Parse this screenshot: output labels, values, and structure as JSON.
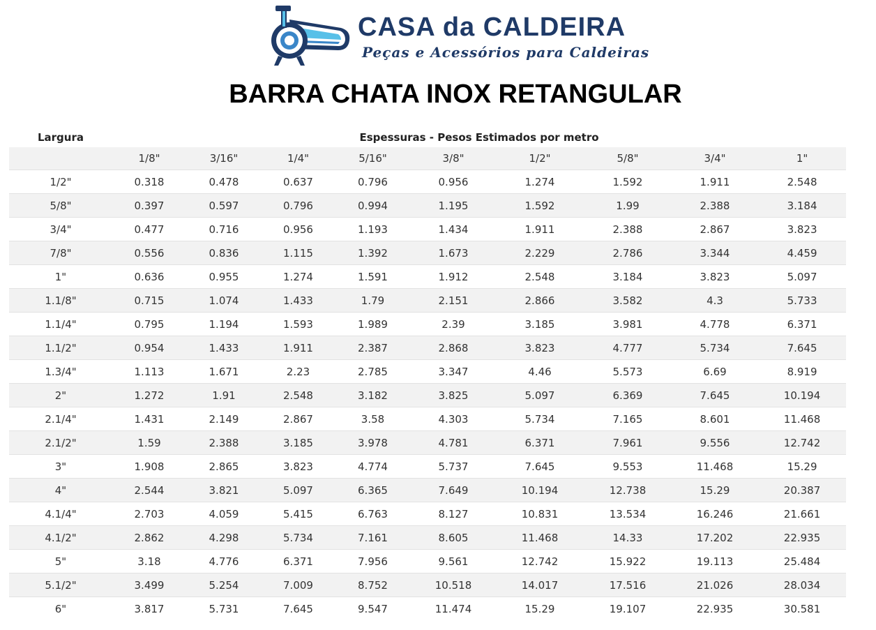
{
  "brand": {
    "name": "CASA da CALDEIRA",
    "tagline": "Peças e Acessórios para Caldeiras",
    "colors": {
      "primary": "#1f3a67",
      "accent": "#3a86c8",
      "icon_light": "#58c0e8"
    }
  },
  "title": "BARRA CHATA INOX RETANGULAR",
  "table": {
    "row_header_label": "Largura",
    "group_header": "Espessuras - Pesos Estimados por metro",
    "thickness_columns": [
      "1/8\"",
      "3/16\"",
      "1/4\"",
      "5/16\"",
      "3/8\"",
      "1/2\"",
      "5/8\"",
      "3/4\"",
      "1\""
    ],
    "rows": [
      {
        "width": "1/2\"",
        "values": [
          "0.318",
          "0.478",
          "0.637",
          "0.796",
          "0.956",
          "1.274",
          "1.592",
          "1.911",
          "2.548"
        ]
      },
      {
        "width": "5/8\"",
        "values": [
          "0.397",
          "0.597",
          "0.796",
          "0.994",
          "1.195",
          "1.592",
          "1.99",
          "2.388",
          "3.184"
        ]
      },
      {
        "width": "3/4\"",
        "values": [
          "0.477",
          "0.716",
          "0.956",
          "1.193",
          "1.434",
          "1.911",
          "2.388",
          "2.867",
          "3.823"
        ]
      },
      {
        "width": "7/8\"",
        "values": [
          "0.556",
          "0.836",
          "1.115",
          "1.392",
          "1.673",
          "2.229",
          "2.786",
          "3.344",
          "4.459"
        ]
      },
      {
        "width": "1\"",
        "values": [
          "0.636",
          "0.955",
          "1.274",
          "1.591",
          "1.912",
          "2.548",
          "3.184",
          "3.823",
          "5.097"
        ]
      },
      {
        "width": "1.1/8\"",
        "values": [
          "0.715",
          "1.074",
          "1.433",
          "1.79",
          "2.151",
          "2.866",
          "3.582",
          "4.3",
          "5.733"
        ]
      },
      {
        "width": "1.1/4\"",
        "values": [
          "0.795",
          "1.194",
          "1.593",
          "1.989",
          "2.39",
          "3.185",
          "3.981",
          "4.778",
          "6.371"
        ]
      },
      {
        "width": "1.1/2\"",
        "values": [
          "0.954",
          "1.433",
          "1.911",
          "2.387",
          "2.868",
          "3.823",
          "4.777",
          "5.734",
          "7.645"
        ]
      },
      {
        "width": "1.3/4\"",
        "values": [
          "1.113",
          "1.671",
          "2.23",
          "2.785",
          "3.347",
          "4.46",
          "5.573",
          "6.69",
          "8.919"
        ]
      },
      {
        "width": "2\"",
        "values": [
          "1.272",
          "1.91",
          "2.548",
          "3.182",
          "3.825",
          "5.097",
          "6.369",
          "7.645",
          "10.194"
        ]
      },
      {
        "width": "2.1/4\"",
        "values": [
          "1.431",
          "2.149",
          "2.867",
          "3.58",
          "4.303",
          "5.734",
          "7.165",
          "8.601",
          "11.468"
        ]
      },
      {
        "width": "2.1/2\"",
        "values": [
          "1.59",
          "2.388",
          "3.185",
          "3.978",
          "4.781",
          "6.371",
          "7.961",
          "9.556",
          "12.742"
        ]
      },
      {
        "width": "3\"",
        "values": [
          "1.908",
          "2.865",
          "3.823",
          "4.774",
          "5.737",
          "7.645",
          "9.553",
          "11.468",
          "15.29"
        ]
      },
      {
        "width": "4\"",
        "values": [
          "2.544",
          "3.821",
          "5.097",
          "6.365",
          "7.649",
          "10.194",
          "12.738",
          "15.29",
          "20.387"
        ]
      },
      {
        "width": "4.1/4\"",
        "values": [
          "2.703",
          "4.059",
          "5.415",
          "6.763",
          "8.127",
          "10.831",
          "13.534",
          "16.246",
          "21.661"
        ]
      },
      {
        "width": "4.1/2\"",
        "values": [
          "2.862",
          "4.298",
          "5.734",
          "7.161",
          "8.605",
          "11.468",
          "14.33",
          "17.202",
          "22.935"
        ]
      },
      {
        "width": "5\"",
        "values": [
          "3.18",
          "4.776",
          "6.371",
          "7.956",
          "9.561",
          "12.742",
          "15.922",
          "19.113",
          "25.484"
        ]
      },
      {
        "width": "5.1/2\"",
        "values": [
          "3.499",
          "5.254",
          "7.009",
          "8.752",
          "10.518",
          "14.017",
          "17.516",
          "21.026",
          "28.034"
        ]
      },
      {
        "width": "6\"",
        "values": [
          "3.817",
          "5.731",
          "7.645",
          "9.547",
          "11.474",
          "15.29",
          "19.107",
          "22.935",
          "30.581"
        ]
      }
    ]
  }
}
